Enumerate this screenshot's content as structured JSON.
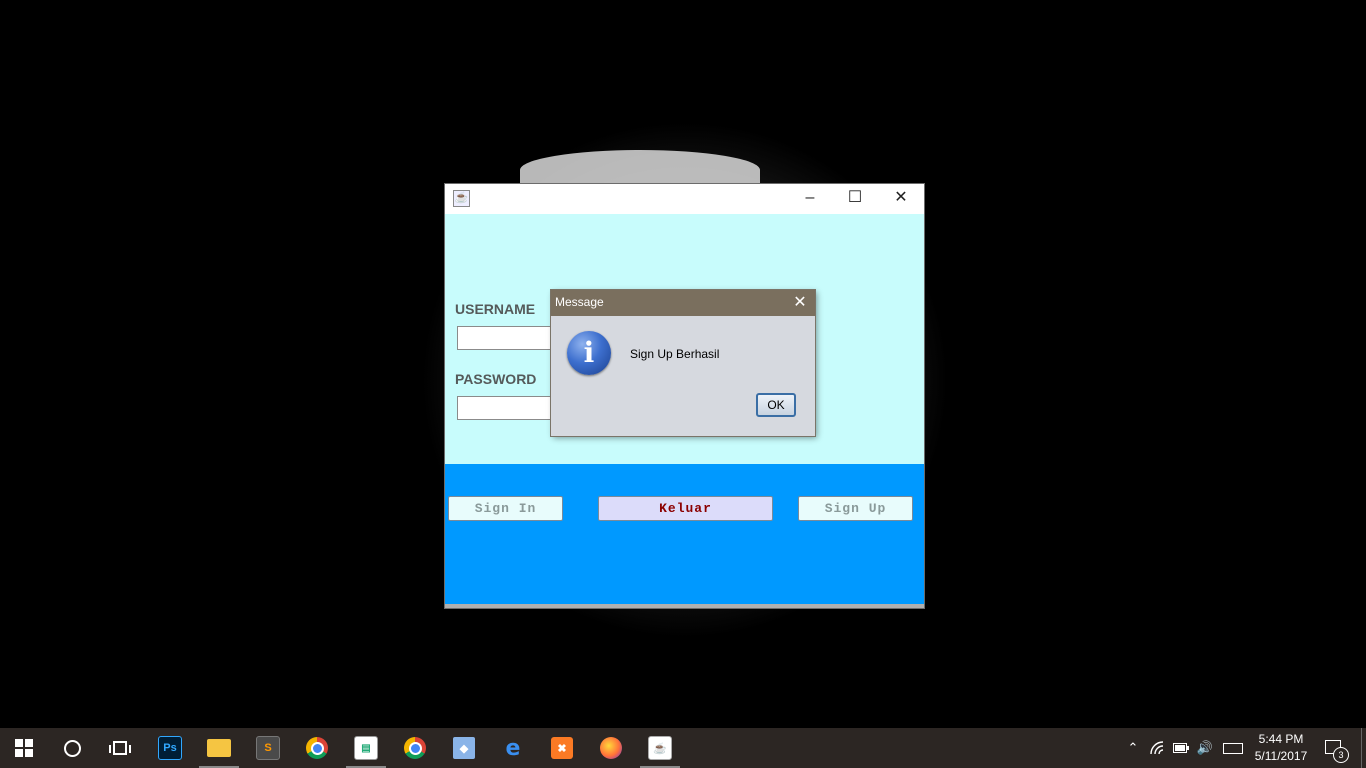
{
  "main_window": {
    "title_buttons": {
      "minimize": "–",
      "maximize": "☐",
      "close": "✕"
    },
    "username_label": "USERNAME",
    "password_label": "PASSWORD",
    "username_value": "",
    "password_value": "",
    "buttons": {
      "sign_in": "Sign In",
      "keluar": "Keluar",
      "sign_up": "Sign Up"
    },
    "colors": {
      "form_bg": "#c8fcfc",
      "button_panel_bg": "#0099ff",
      "keluar_text": "#8b0000"
    }
  },
  "dialog": {
    "title": "Message",
    "close": "✕",
    "icon": "info-icon",
    "icon_glyph": "i",
    "message": "Sign Up Berhasil",
    "ok_label": "OK"
  },
  "taskbar": {
    "icons": [
      "start-icon",
      "cortana-icon",
      "task-view-icon",
      "photoshop-icon",
      "file-explorer-icon",
      "sublime-text-icon",
      "chrome-icon",
      "document-icon",
      "chrome-icon",
      "cube-app-icon",
      "edge-icon",
      "xampp-icon",
      "firefox-icon",
      "java-icon"
    ],
    "ps_label": "Ps",
    "sublime_label": "S",
    "edge_label": "e",
    "xampp_label": "✖",
    "java_label": "☕",
    "tray": {
      "chevron": "⌃",
      "volume": "🔊"
    },
    "time": "5:44 PM",
    "date": "5/11/2017",
    "notification_count": "3"
  }
}
